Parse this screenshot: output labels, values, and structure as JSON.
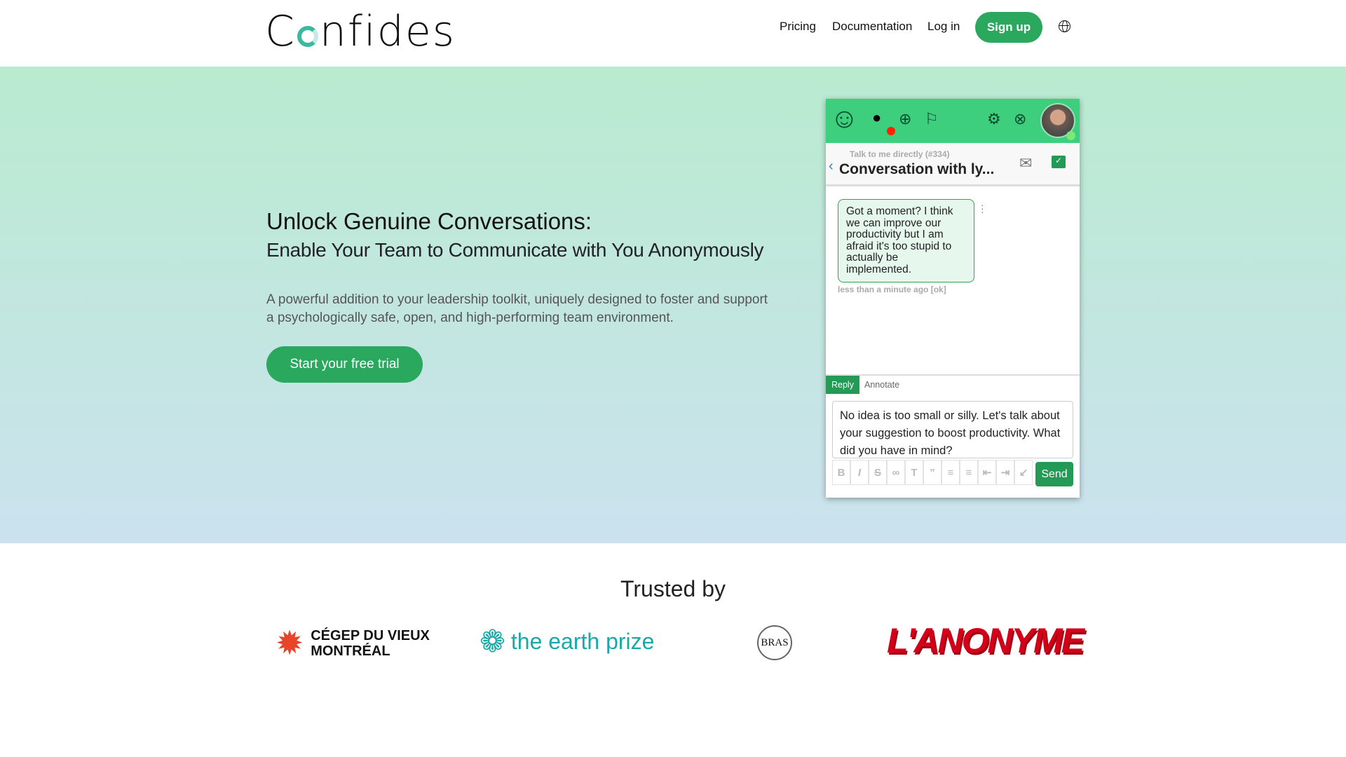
{
  "header": {
    "logo": "Confides",
    "nav": [
      "Pricing",
      "Documentation",
      "Log in"
    ],
    "signup": "Sign up",
    "language_icon": "globe-icon"
  },
  "hero": {
    "title": "Unlock Genuine Conversations:",
    "subtitle": "Enable Your Team to Communicate with You Anonymously",
    "description": "A powerful addition to your leadership toolkit, uniquely designed to foster and support a psychologically safe, open, and high-performing team environment.",
    "cta": "Start your free trial"
  },
  "widget": {
    "channel": "Talk to me directly (#334)",
    "title": "Conversation with ly...",
    "message": "Got a moment? I think we can improve our productivity but I am afraid it's too stupid to actually be implemented.",
    "message_meta": "less than a minute ago [ok]",
    "tabs": [
      "Reply",
      "Annotate"
    ],
    "reply_text": "No idea is too small or silly. Let's talk about your suggestion to boost productivity. What did you have in mind?",
    "send": "Send",
    "colors": {
      "header": "#3ecf7e",
      "accent": "#239a55",
      "notification": "#ff2200"
    }
  },
  "trusted": {
    "title": "Trusted by",
    "logos": [
      "CÉGEP DU VIEUX MONTRÉAL",
      "the earth prize",
      "BRAS",
      "L'ANONYME"
    ]
  }
}
